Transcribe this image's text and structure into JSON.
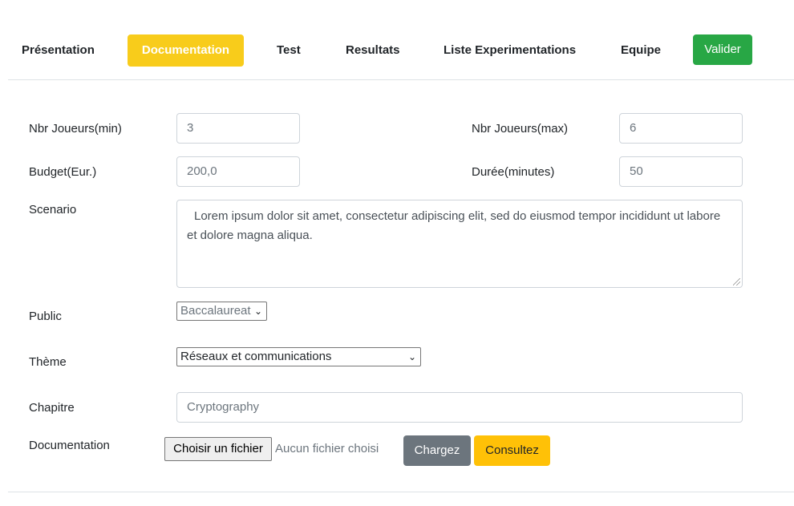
{
  "nav": {
    "items": [
      {
        "label": "Présentation"
      },
      {
        "label": "Documentation",
        "active": true
      },
      {
        "label": "Test"
      },
      {
        "label": "Resultats"
      },
      {
        "label": "Liste Experimentations"
      },
      {
        "label": "Equipe"
      }
    ],
    "valider_label": "Valider",
    "active_color": "#f8cc1b",
    "valider_color": "#28a745"
  },
  "form": {
    "nbr_joueurs_min_label": "Nbr Joueurs(min)",
    "nbr_joueurs_min_value": "3",
    "nbr_joueurs_max_label": "Nbr Joueurs(max)",
    "nbr_joueurs_max_value": "6",
    "budget_label": "Budget(Eur.)",
    "budget_value": "200,0",
    "duree_label": "Durée(minutes)",
    "duree_value": "50",
    "scenario_label": "Scenario",
    "scenario_value": "Lorem ipsum dolor sit amet, consectetur adipiscing elit, sed do eiusmod tempor incididunt ut labore et dolore magna aliqua.",
    "public_label": "Public",
    "public_value": "Baccalaureat",
    "theme_label": "Thème",
    "theme_value": "Réseaux et communications",
    "chapitre_label": "Chapitre",
    "chapitre_placeholder": "Cryptography",
    "documentation_label": "Documentation",
    "file_button_label": "Choisir un fichier",
    "file_status": "Aucun fichier choisi",
    "charge_label": "Chargez",
    "consult_label": "Consultez",
    "charge_color": "#6c757d",
    "consult_color": "#ffc107"
  }
}
